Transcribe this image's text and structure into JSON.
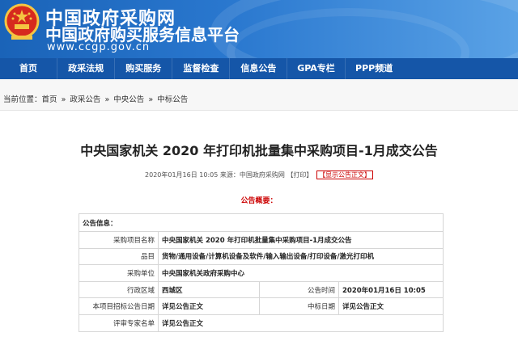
{
  "header": {
    "site_title": "中国政府采购网",
    "site_subtitle": "中国政府购买服务信息平台",
    "site_domain": "www.ccgp.gov.cn",
    "emblem_icon": "national-emblem-icon",
    "colors": {
      "header_blue": "#1a63b8",
      "nav_blue": "#1556a8",
      "accent_red": "#cc0000"
    }
  },
  "nav": {
    "items": [
      {
        "label": "首页"
      },
      {
        "label": "政采法规"
      },
      {
        "label": "购买服务"
      },
      {
        "label": "监督检查"
      },
      {
        "label": "信息公告"
      },
      {
        "label": "GPA专栏"
      },
      {
        "label": "PPP频道"
      }
    ]
  },
  "breadcrumb": {
    "prefix": "当前位置：",
    "items": [
      "首页",
      "政采公告",
      "中央公告",
      "中标公告"
    ],
    "separator": "»"
  },
  "article": {
    "title": "中央国家机关 2020 年打印机批量集中采购项目-1月成交公告",
    "date": "2020年01月16日 10:05",
    "source": "来源：中国政府采购网",
    "print": "【打印】",
    "show_text": "【显示公告正文】",
    "summary_label": "公告概要："
  },
  "info": {
    "header": "公告信息：",
    "rows": {
      "project_name": {
        "label": "采购项目名称",
        "value": "中央国家机关 2020 年打印机批量集中采购项目-1月成交公告"
      },
      "category": {
        "label": "品目",
        "value": "货物/通用设备/计算机设备及软件/输入输出设备/打印设备/激光打印机"
      },
      "purchaser": {
        "label": "采购单位",
        "value": "中央国家机关政府采购中心"
      },
      "region": {
        "label": "行政区域",
        "value": "西城区"
      },
      "publish_time": {
        "label": "公告时间",
        "value": "2020年01月16日 10:05"
      },
      "bid_notice_date": {
        "label": "本项目招标公告日期",
        "value": "详见公告正文"
      },
      "award_date": {
        "label": "中标日期",
        "value": "详见公告正文"
      },
      "experts": {
        "label": "评审专家名单",
        "value": "详见公告正文"
      }
    }
  }
}
